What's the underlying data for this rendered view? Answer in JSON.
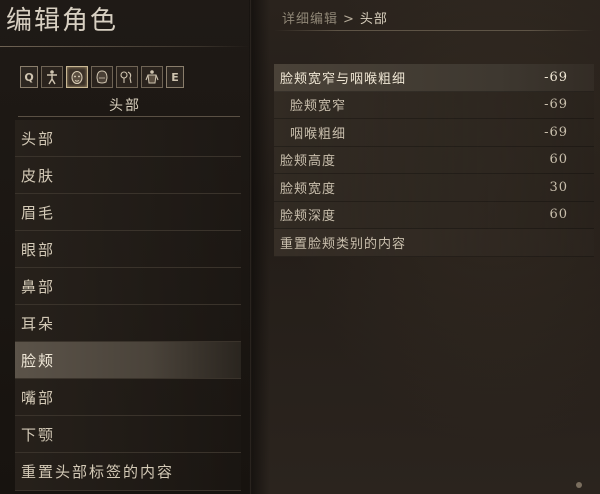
{
  "title": "编辑角色",
  "tabs": [
    {
      "name": "key-q",
      "label": "Q",
      "type": "key"
    },
    {
      "name": "body-icon",
      "label": "",
      "type": "icon"
    },
    {
      "name": "face-icon",
      "label": "",
      "type": "icon",
      "active": true
    },
    {
      "name": "head-hair-icon",
      "label": "",
      "type": "icon"
    },
    {
      "name": "features-icon",
      "label": "",
      "type": "icon"
    },
    {
      "name": "torso-icon",
      "label": "",
      "type": "icon"
    },
    {
      "name": "key-e",
      "label": "E",
      "type": "key"
    }
  ],
  "category_label": "头部",
  "menu": [
    {
      "label": "头部"
    },
    {
      "label": "皮肤"
    },
    {
      "label": "眉毛"
    },
    {
      "label": "眼部"
    },
    {
      "label": "鼻部"
    },
    {
      "label": "耳朵"
    },
    {
      "label": "脸颊",
      "selected": true
    },
    {
      "label": "嘴部"
    },
    {
      "label": "下颚"
    },
    {
      "label": "重置头部标签的内容"
    }
  ],
  "breadcrumb": {
    "parent": "详细编辑",
    "separator": ">",
    "current": "头部"
  },
  "settings": [
    {
      "label": "脸颊宽窄与咽喉粗细",
      "value": "-69",
      "kind": "header"
    },
    {
      "label": "脸颊宽窄",
      "value": "-69",
      "kind": "sub"
    },
    {
      "label": "咽喉粗细",
      "value": "-69",
      "kind": "sub"
    },
    {
      "label": "脸颊高度",
      "value": "60",
      "kind": "normal"
    },
    {
      "label": "脸颊宽度",
      "value": "30",
      "kind": "normal"
    },
    {
      "label": "脸颊深度",
      "value": "60",
      "kind": "normal"
    },
    {
      "label": "重置脸颊类别的内容",
      "value": "",
      "kind": "reset"
    }
  ],
  "colors": {
    "background": "#1e1915",
    "text": "#cfc4b0",
    "selected_row": "#5b5349",
    "header_row": "#4a4238"
  }
}
